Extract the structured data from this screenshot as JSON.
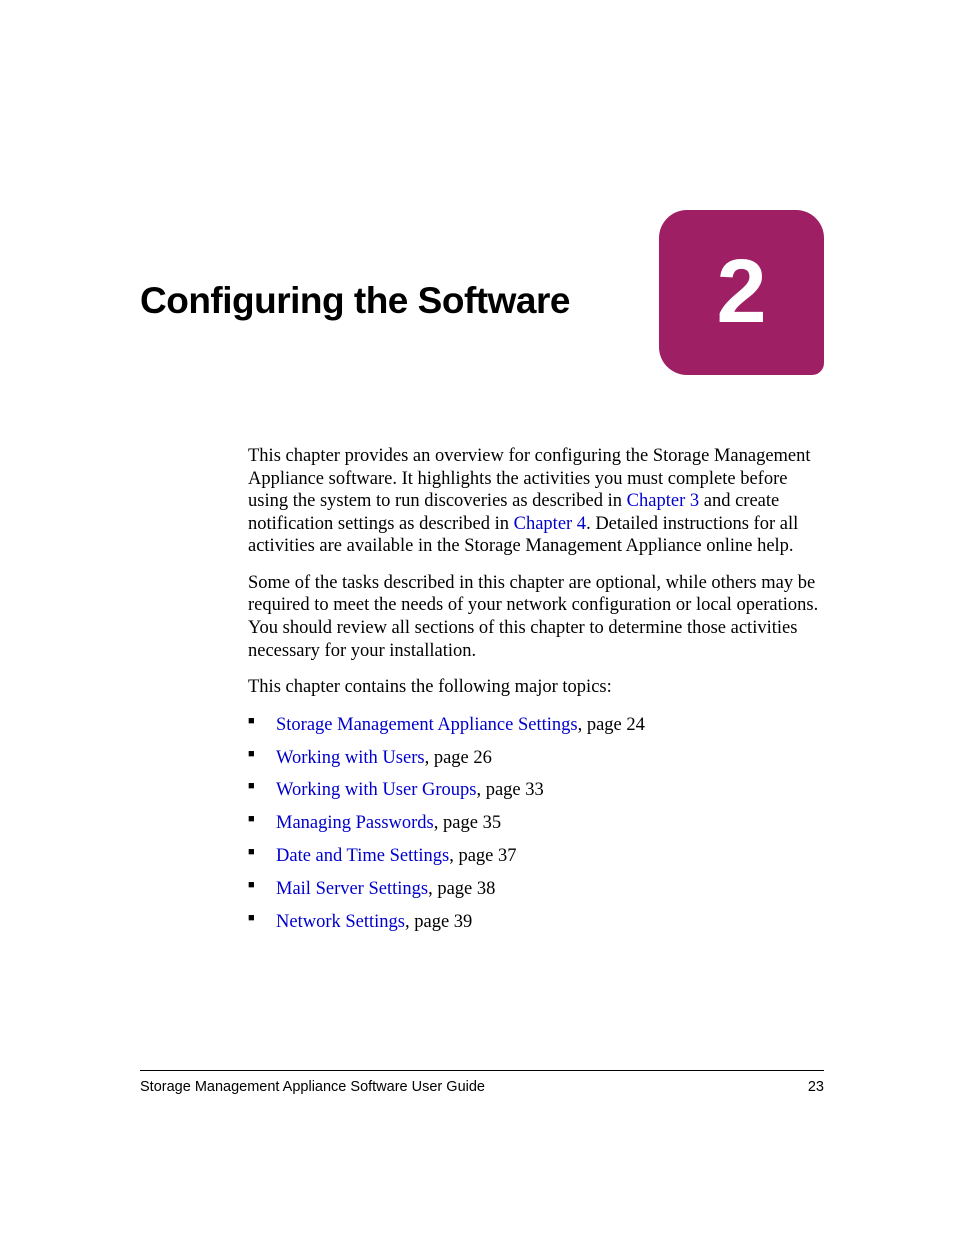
{
  "chapter": {
    "title": "Configuring the Software",
    "number": "2"
  },
  "intro": {
    "p1_a": "This chapter provides an overview for configuring the Storage Management Appliance software. It highlights the activities you must complete before using the system to run discoveries as described in ",
    "p1_link1": "Chapter 3",
    "p1_b": " and create notification settings as described in ",
    "p1_link2": "Chapter 4",
    "p1_c": ". Detailed instructions for all activities are available in the Storage Management Appliance online help.",
    "p2": "Some of the tasks described in this chapter are optional, while others may be required to meet the needs of your network configuration or local operations. You should review all sections of this chapter to determine those activities necessary for your installation.",
    "p3": "This chapter contains the following major topics:"
  },
  "topics": [
    {
      "link": "Storage Management Appliance Settings",
      "suffix": ", page 24"
    },
    {
      "link": "Working with Users",
      "suffix": ", page 26"
    },
    {
      "link": "Working with User Groups",
      "suffix": ", page 33"
    },
    {
      "link": "Managing Passwords",
      "suffix": ", page 35"
    },
    {
      "link": "Date and Time Settings",
      "suffix": ", page 37"
    },
    {
      "link": "Mail Server Settings",
      "suffix": ", page 38"
    },
    {
      "link": "Network Settings",
      "suffix": ", page 39"
    }
  ],
  "footer": {
    "doc_title": "Storage Management Appliance Software User Guide",
    "page_number": "23"
  }
}
